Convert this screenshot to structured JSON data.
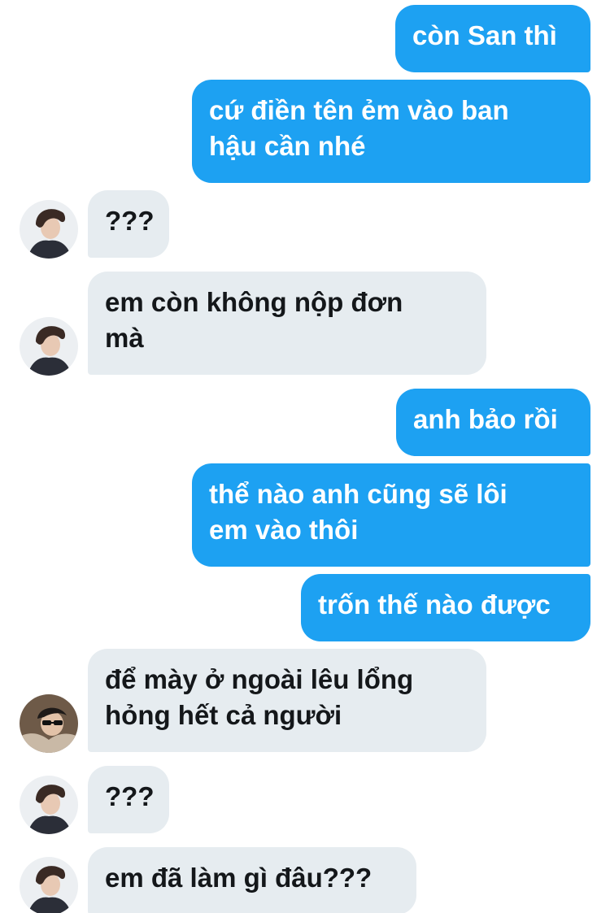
{
  "conversation": {
    "messages": [
      {
        "side": "outgoing",
        "text": "còn San thì"
      },
      {
        "side": "outgoing",
        "text": "cứ điền tên ẻm vào ban\nhậu cần nhé"
      },
      {
        "side": "incoming",
        "text": "???"
      },
      {
        "side": "incoming",
        "text": "em còn không nộp đơn\nmà"
      },
      {
        "side": "outgoing",
        "text": "anh bảo rồi"
      },
      {
        "side": "outgoing",
        "text": "thể nào anh cũng sẽ lôi\nem vào thôi"
      },
      {
        "side": "outgoing",
        "text": "trốn thế nào được"
      },
      {
        "side": "incoming",
        "text": "để mày ở ngoài lêu lổng\nhỏng hết cả người"
      },
      {
        "side": "incoming",
        "text": "???"
      },
      {
        "side": "incoming",
        "text": "em đã làm gì đâu???"
      }
    ]
  },
  "colors": {
    "outgoing_bubble": "#1da1f2",
    "incoming_bubble": "#e6ecf0",
    "outgoing_text": "#ffffff",
    "incoming_text": "#14171a"
  }
}
